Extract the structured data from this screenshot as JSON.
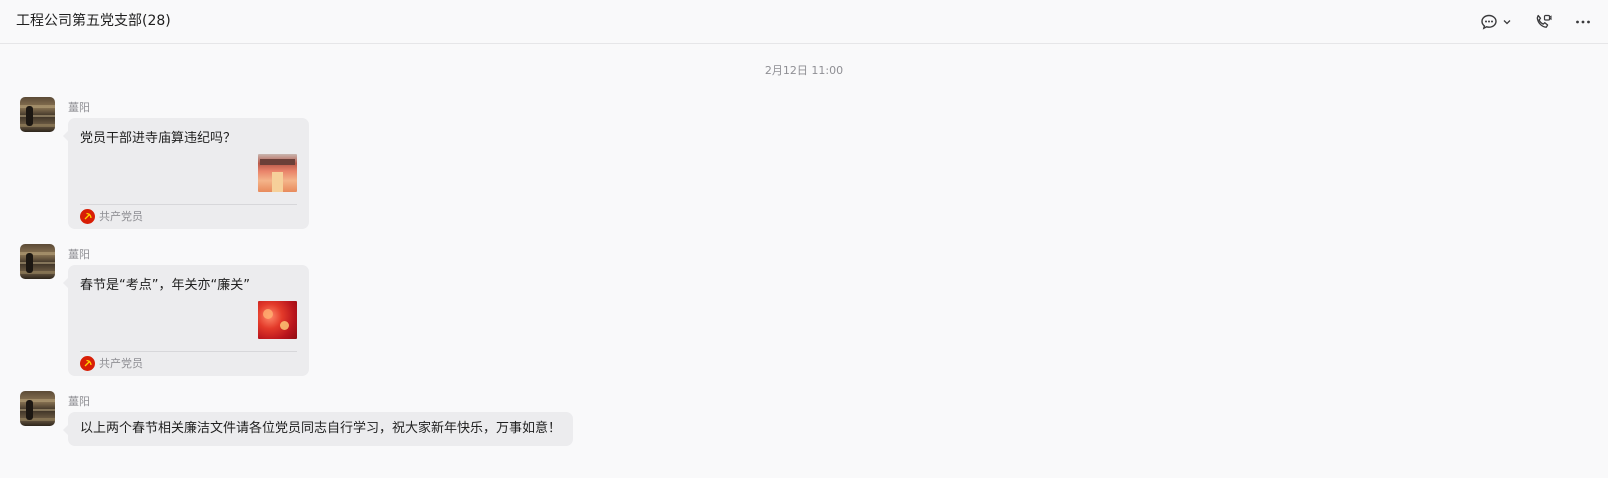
{
  "header": {
    "title": "工程公司第五党支部(28)",
    "icons": [
      "chat-icon",
      "chevron-down-icon",
      "phone-call-icon",
      "more-icon"
    ]
  },
  "timestamp": "2月12日 11:00",
  "messages": [
    {
      "sender": "薑阳",
      "type": "card",
      "title": "党员干部进寺庙算违纪吗？",
      "thumbnail": "temple",
      "source": "共产党员"
    },
    {
      "sender": "薑阳",
      "type": "card",
      "title": "春节是“考点”，年关亦“廉关”",
      "thumbnail": "lantern",
      "source": "共产党员"
    },
    {
      "sender": "薑阳",
      "type": "text",
      "text": "以上两个春节相关廉洁文件请各位党员同志自行学习，祝大家新年快乐，万事如意！"
    }
  ],
  "colors": {
    "background": "#f9f9fa",
    "bubble": "#ececee",
    "party_icon": "#d81e06",
    "muted_text": "#8f8f94"
  }
}
